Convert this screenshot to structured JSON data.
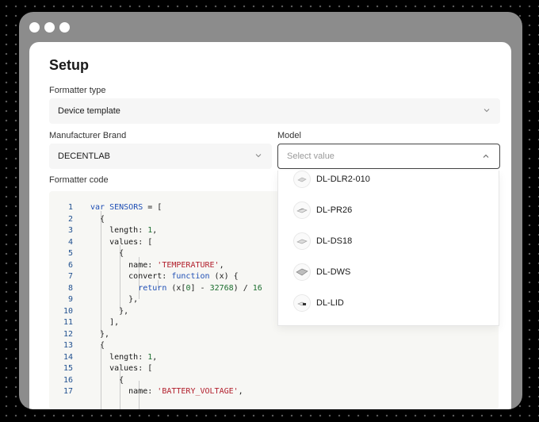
{
  "page": {
    "title": "Setup"
  },
  "form": {
    "formatter_type_label": "Formatter type",
    "formatter_type_value": "Device template",
    "brand_label": "Manufacturer Brand",
    "brand_value": "DECENTLAB",
    "model_label": "Model",
    "model_placeholder": "Select value",
    "code_label": "Formatter code"
  },
  "model_options": [
    {
      "label": "DL-DLR2-010",
      "icon": "device-thumbnail-icon"
    },
    {
      "label": "DL-PR26",
      "icon": "device-thumbnail-icon"
    },
    {
      "label": "DL-DS18",
      "icon": "device-thumbnail-icon"
    },
    {
      "label": "DL-DWS",
      "icon": "device-thumbnail-icon"
    },
    {
      "label": "DL-LID",
      "icon": "device-thumbnail-icon"
    }
  ],
  "code_lines": [
    {
      "n": "1",
      "text": "var SENSORS = ["
    },
    {
      "n": "2",
      "text": "  {"
    },
    {
      "n": "3",
      "text": "    length: 1,"
    },
    {
      "n": "4",
      "text": "    values: ["
    },
    {
      "n": "5",
      "text": "      {"
    },
    {
      "n": "6",
      "text": "        name: 'TEMPERATURE',"
    },
    {
      "n": "7",
      "text": "        convert: function (x) {"
    },
    {
      "n": "8",
      "text": "          return (x[0] - 32768) / 16"
    },
    {
      "n": "9",
      "text": "        },"
    },
    {
      "n": "10",
      "text": "      },"
    },
    {
      "n": "11",
      "text": "    ],"
    },
    {
      "n": "12",
      "text": "  },"
    },
    {
      "n": "13",
      "text": "  {"
    },
    {
      "n": "14",
      "text": "    length: 1,"
    },
    {
      "n": "15",
      "text": "    values: ["
    },
    {
      "n": "16",
      "text": "      {"
    },
    {
      "n": "17",
      "text": "        name: 'BATTERY_VOLTAGE',"
    }
  ],
  "colors": {
    "keyword": "#1f4fb5",
    "number": "#1b6e2e",
    "string": "#b2202d",
    "line_number": "#1f4f8f"
  }
}
